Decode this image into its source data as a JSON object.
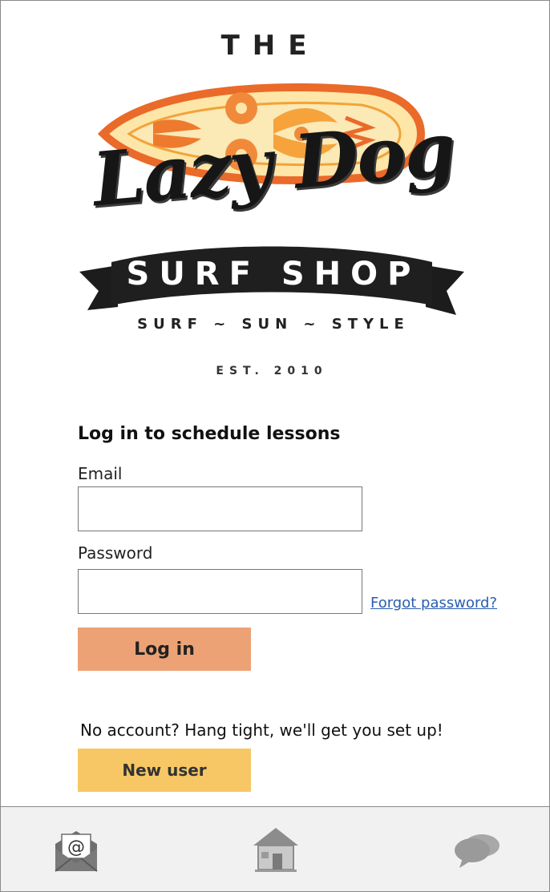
{
  "logo": {
    "the": "THE",
    "name": "Lazy Dog",
    "surf_shop": "SURF SHOP",
    "tagline": "SURF ~ SUN ~ STYLE",
    "established": "EST. 2010"
  },
  "login": {
    "heading": "Log in to schedule lessons",
    "email_label": "Email",
    "email_value": "",
    "password_label": "Password",
    "password_value": "",
    "forgot_password": "Forgot password?",
    "login_button": "Log in"
  },
  "signup": {
    "prompt": "No account?  Hang tight, we'll get you set up!",
    "new_user_button": "New user"
  },
  "bottom_nav": {
    "items": [
      {
        "icon": "mail-icon"
      },
      {
        "icon": "home-icon"
      },
      {
        "icon": "chat-icon"
      }
    ]
  },
  "colors": {
    "login_button": "#eda276",
    "new_user_button": "#f6c764",
    "link": "#2a5db0",
    "bottom_bar": "#f1f1f1"
  }
}
